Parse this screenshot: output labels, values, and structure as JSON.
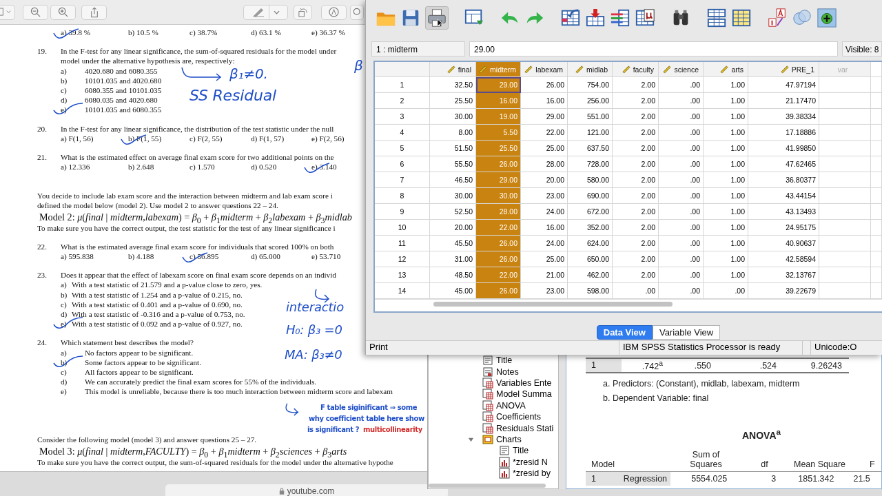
{
  "document": [
    {
      "kind": "options_row",
      "options": [
        {
          "text": "a) 39.8 %",
          "marked": true
        },
        {
          "text": "b) 10.5 %",
          "marked": false
        },
        {
          "text": "c) 38.7%",
          "marked": false
        },
        {
          "text": "d) 63.1 %",
          "marked": false
        },
        {
          "text": "e) 36.37 %",
          "marked": false
        }
      ]
    },
    {
      "kind": "question",
      "number": "19.",
      "text": "In the F-test for any linear significance, the sum-of-squared residuals for the model under"
    },
    {
      "kind": "continuation",
      "text": "model under the alternative hypothesis are, respectively:"
    },
    {
      "kind": "option",
      "letter": "a)",
      "text": "4020.680 and 6080.355",
      "marked": false
    },
    {
      "kind": "option",
      "letter": "b)",
      "text": "10101.035 and 4020.680",
      "marked": false
    },
    {
      "kind": "option",
      "letter": "c)",
      "text": "6080.355 and 10101.035",
      "marked": false
    },
    {
      "kind": "option",
      "letter": "d)",
      "text": "6080.035 and 4020.680",
      "marked": false
    },
    {
      "kind": "option",
      "letter": "e)",
      "text": "10101.035 and 6080.355",
      "marked": true
    },
    {
      "kind": "question",
      "number": "20.",
      "text": "In the F-test for any linear significance, the distribution of the test statistic under the null"
    },
    {
      "kind": "options_row",
      "options": [
        {
          "text": "a) F(1, 56)",
          "marked": false
        },
        {
          "text": "b) F(1, 55)",
          "marked": true
        },
        {
          "text": "c) F(2, 55)",
          "marked": false
        },
        {
          "text": "d) F(1, 57)",
          "marked": false
        },
        {
          "text": "e) F(2, 56)",
          "marked": false
        }
      ]
    },
    {
      "kind": "question",
      "number": "21.",
      "text": "What is the estimated effect on average final exam score for two additional points on the"
    },
    {
      "kind": "options_row",
      "options": [
        {
          "text": "a) 12.336",
          "marked": false
        },
        {
          "text": "b) 2.648",
          "marked": false
        },
        {
          "text": "c) 1.570",
          "marked": false
        },
        {
          "text": "d) 0.520",
          "marked": false
        },
        {
          "text": "e) 3.140",
          "marked": true
        }
      ]
    },
    {
      "kind": "para",
      "text": "You decide to include lab exam score and the interaction between midterm and lab exam score i"
    },
    {
      "kind": "line",
      "text": "defined the model below (model 2).  Use model 2 to answer questions 22 – 24."
    },
    {
      "kind": "formula",
      "text": "Model 2:  *μ*(*final* | *midterm*,*labexam*) = *β*$_{0}$ + *β*$_{1}$*midterm* + *β*$_{2}$*labexam* + *β*$_{3}$*midlab*"
    },
    {
      "kind": "line",
      "text": "To make sure you have the correct output, the test statistic for the test of any linear significance i"
    },
    {
      "kind": "question",
      "number": "22.",
      "text": "What is the estimated average final exam score for individuals that scored 100% on both"
    },
    {
      "kind": "options_row",
      "options": [
        {
          "text": "a) 595.838",
          "marked": false
        },
        {
          "text": "b) 4.188",
          "marked": false
        },
        {
          "text": "c) 56.895",
          "marked": true
        },
        {
          "text": "d) 65.000",
          "marked": false
        },
        {
          "text": "e) 53.710",
          "marked": false
        }
      ]
    },
    {
      "kind": "question",
      "number": "23.",
      "text": "Does it appear that the effect of labexam score on final exam score depends on an individ"
    },
    {
      "kind": "option_tight",
      "letter": "a)",
      "text": "With a test statistic of 21.579 and a p-value close to zero, yes.",
      "marked": false
    },
    {
      "kind": "option_tight",
      "letter": "b)",
      "text": "With a test statistic of 1.254 and a p-value of 0.215, no.",
      "marked": false
    },
    {
      "kind": "option_tight",
      "letter": "c)",
      "text": "With a test statistic of 0.401 and a p-value of 0.690, no.",
      "marked": false
    },
    {
      "kind": "option_tight",
      "letter": "d)",
      "text": "With a test statistic of -0.316 and a p-value of 0.753, no.",
      "marked": false
    },
    {
      "kind": "option_tight",
      "letter": "e)",
      "text": "With a test statistic of 0.092 and a p-value of 0.927, no.",
      "marked": true
    },
    {
      "kind": "question",
      "number": "24.",
      "text": "Which statement best describes the model?"
    },
    {
      "kind": "option",
      "letter": "a)",
      "text": "No factors appear to be significant.",
      "marked": false
    },
    {
      "kind": "option",
      "letter": "b)",
      "text": "Some factors appear to be significant.",
      "marked": true
    },
    {
      "kind": "option",
      "letter": "c)",
      "text": "All factors appear to be significant.",
      "marked": false
    },
    {
      "kind": "option",
      "letter": "d)",
      "text": "We can accurately predict the final exam scores for 55% of the individuals.",
      "marked": false
    },
    {
      "kind": "option",
      "letter": "e)",
      "text": "This model is unreliable, because there is too much interaction between midterm score and labexam",
      "marked": false
    },
    {
      "kind": "section",
      "text": "Consider the following model (model 3) and answer questions 25 – 27."
    },
    {
      "kind": "formula",
      "text": "Model 3:  *μ*(*final* | *midterm*,*FACULTY*) = *β*$_{0}$ + *β*$_{1}$*midterm* + *β*$_{2}$*sciences* + *β*$_{3}$*arts*"
    },
    {
      "kind": "line",
      "text": "To make sure you have the correct output, the sum-of-squared residuals for the model under the alternative hypothe"
    }
  ],
  "annotations": [
    {
      "text": "β₁≠0.",
      "color": "#1f4fc8"
    },
    {
      "text": "β",
      "color": "#1f4fc8"
    },
    {
      "text": "SS Residual",
      "color": "#1f4fc8"
    },
    {
      "text": "interactio",
      "color": "#1f4fc8"
    },
    {
      "text": "H₀: β₃ =0",
      "color": "#1f4fc8"
    },
    {
      "text": "MA: β₃≠0",
      "color": "#1f4fc8"
    },
    {
      "text": "F table siginificant ⇒ some",
      "color": "#1f4fc8"
    },
    {
      "text": "why coefficient table here show",
      "color": "#1f4fc8"
    },
    {
      "text": "is significant ?",
      "color": "#1f4fc8"
    },
    {
      "text": "multicollinearity",
      "color": "#d42a2a"
    }
  ],
  "browser": {
    "address": "youtube.com"
  },
  "data_editor": {
    "cell_ref": "1 : midterm",
    "cell_value": "29.00",
    "visible": "Visible: 8",
    "columns": [
      {
        "name": "final",
        "kind": "scale",
        "selected": false
      },
      {
        "name": "midterm",
        "kind": "scale",
        "selected": true
      },
      {
        "name": "labexam",
        "kind": "scale",
        "selected": false
      },
      {
        "name": "midlab",
        "kind": "scale",
        "selected": false
      },
      {
        "name": "faculty",
        "kind": "scale",
        "selected": false
      },
      {
        "name": "science",
        "kind": "scale",
        "selected": false
      },
      {
        "name": "arts",
        "kind": "scale",
        "selected": false
      },
      {
        "name": "PRE_1",
        "kind": "scale",
        "selected": false
      },
      {
        "name": "var",
        "kind": "empty",
        "selected": false
      }
    ],
    "rows": [
      {
        "number": "1",
        "selected": true,
        "cells": [
          "32.50",
          "29.00",
          "26.00",
          "754.00",
          "2.00",
          ".00",
          "1.00",
          "47.97194"
        ]
      },
      {
        "number": "2",
        "selected": false,
        "cells": [
          "25.50",
          "16.00",
          "16.00",
          "256.00",
          "2.00",
          ".00",
          "1.00",
          "21.17470"
        ]
      },
      {
        "number": "3",
        "selected": false,
        "cells": [
          "30.00",
          "19.00",
          "29.00",
          "551.00",
          "2.00",
          ".00",
          "1.00",
          "39.38334"
        ]
      },
      {
        "number": "4",
        "selected": false,
        "cells": [
          "8.00",
          "5.50",
          "22.00",
          "121.00",
          "2.00",
          ".00",
          "1.00",
          "17.18886"
        ]
      },
      {
        "number": "5",
        "selected": false,
        "cells": [
          "51.50",
          "25.50",
          "25.00",
          "637.50",
          "2.00",
          ".00",
          "1.00",
          "41.99850"
        ]
      },
      {
        "number": "6",
        "selected": false,
        "cells": [
          "55.50",
          "26.00",
          "28.00",
          "728.00",
          "2.00",
          ".00",
          "1.00",
          "47.62465"
        ]
      },
      {
        "number": "7",
        "selected": false,
        "cells": [
          "46.50",
          "29.00",
          "20.00",
          "580.00",
          "2.00",
          ".00",
          "1.00",
          "36.80377"
        ]
      },
      {
        "number": "8",
        "selected": false,
        "cells": [
          "30.00",
          "30.00",
          "23.00",
          "690.00",
          "2.00",
          ".00",
          "1.00",
          "43.44154"
        ]
      },
      {
        "number": "9",
        "selected": false,
        "cells": [
          "52.50",
          "28.00",
          "24.00",
          "672.00",
          "2.00",
          ".00",
          "1.00",
          "43.13493"
        ]
      },
      {
        "number": "10",
        "selected": false,
        "cells": [
          "20.00",
          "22.00",
          "16.00",
          "352.00",
          "2.00",
          ".00",
          "1.00",
          "24.95175"
        ]
      },
      {
        "number": "11",
        "selected": false,
        "cells": [
          "45.50",
          "26.00",
          "24.00",
          "624.00",
          "2.00",
          ".00",
          "1.00",
          "40.90637"
        ]
      },
      {
        "number": "12",
        "selected": false,
        "cells": [
          "31.00",
          "26.00",
          "25.00",
          "650.00",
          "2.00",
          ".00",
          "1.00",
          "42.58594"
        ]
      },
      {
        "number": "13",
        "selected": false,
        "cells": [
          "48.50",
          "22.00",
          "21.00",
          "462.00",
          "2.00",
          ".00",
          "1.00",
          "32.13767"
        ]
      },
      {
        "number": "14",
        "selected": false,
        "cells": [
          "45.00",
          "26.00",
          "23.00",
          "598.00",
          ".00",
          ".00",
          ".00",
          "39.22679"
        ]
      }
    ],
    "tabs": [
      {
        "label": "Data View",
        "selected": true
      },
      {
        "label": "Variable View",
        "selected": false
      }
    ],
    "status": [
      "Print",
      "IBM SPSS Statistics Processor is ready",
      "Unicode:O"
    ]
  },
  "output": {
    "navigator": [
      {
        "label": "Title",
        "kind": "title"
      },
      {
        "label": "Notes",
        "kind": "notes"
      },
      {
        "label": "Variables Ente",
        "kind": "table"
      },
      {
        "label": "Model Summa",
        "kind": "table"
      },
      {
        "label": "ANOVA",
        "kind": "table"
      },
      {
        "label": "Coefficients",
        "kind": "table"
      },
      {
        "label": "Residuals Stati",
        "kind": "table"
      },
      {
        "label": "Charts",
        "kind": "folder",
        "expanded": true,
        "children": [
          {
            "label": "Title",
            "kind": "title"
          },
          {
            "label": "*zresid N",
            "kind": "chart"
          },
          {
            "label": "*zresid by",
            "kind": "chart"
          }
        ]
      }
    ],
    "model_summary_row": [
      "1",
      ".742$^{a}$",
      ".550",
      ".524",
      "9.26243"
    ],
    "footnotes": [
      "a. Predictors: (Constant), midlab, labexam, midterm",
      "b. Dependent Variable: final"
    ],
    "anova": {
      "title": "ANOVA$^{a}$",
      "columns": [
        "Model",
        "",
        "Sum of Squares",
        "df",
        "Mean Square",
        "F"
      ],
      "rows": [
        {
          "cells": [
            "1",
            "Regression",
            "5554.025",
            "3",
            "1851.342",
            "21.5"
          ]
        }
      ]
    }
  }
}
